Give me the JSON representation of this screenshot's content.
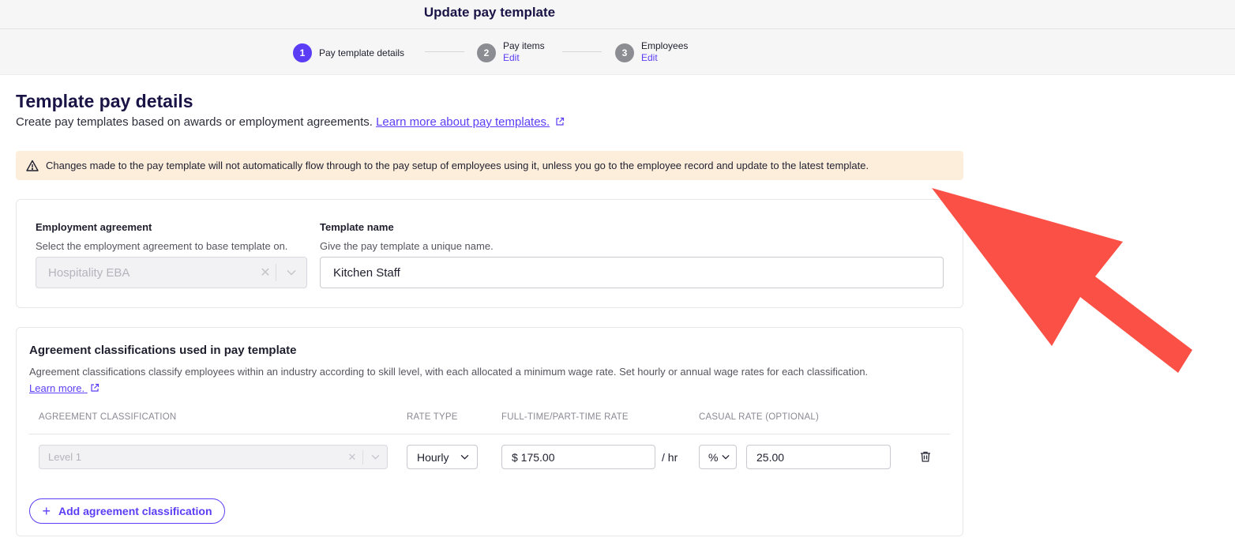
{
  "header": {
    "title": "Update pay template",
    "steps": [
      {
        "num": "1",
        "label": "Pay template details",
        "edit": ""
      },
      {
        "num": "2",
        "label": "Pay items",
        "edit": "Edit"
      },
      {
        "num": "3",
        "label": "Employees",
        "edit": "Edit"
      }
    ]
  },
  "page": {
    "title": "Template pay details",
    "subtitle": "Create pay templates based on awards or employment agreements.",
    "subtitle_link": "Learn more about pay templates."
  },
  "warning": {
    "text": "Changes made to the pay template will not automatically flow through to the pay setup of employees using it, unless you go to the employee record and update to the latest template."
  },
  "details": {
    "agreement_label": "Employment agreement",
    "agreement_help": "Select the employment agreement to base template on.",
    "agreement_value": "Hospitality EBA",
    "name_label": "Template name",
    "name_help": "Give the pay template a unique name.",
    "name_value": "Kitchen Staff"
  },
  "classifications": {
    "title": "Agreement classifications used in pay template",
    "description": "Agreement classifications classify employees within an industry according to skill level, with each allocated a minimum wage rate. Set hourly or annual wage rates for each classification.",
    "learn_more": "Learn more.",
    "columns": [
      "AGREEMENT CLASSIFICATION",
      "RATE TYPE",
      "FULL-TIME/PART-TIME RATE",
      "CASUAL RATE (OPTIONAL)"
    ],
    "rows": [
      {
        "classification": "Level 1",
        "rate_type": "Hourly",
        "rate": "$ 175.00",
        "unit": "/ hr",
        "casual_mode": "%",
        "casual_value": "25.00"
      }
    ],
    "add_label": "Add agreement classification"
  },
  "colors": {
    "accent": "#5b3df5",
    "warning_bg": "#fdeedc",
    "arrow": "#fb5046"
  }
}
